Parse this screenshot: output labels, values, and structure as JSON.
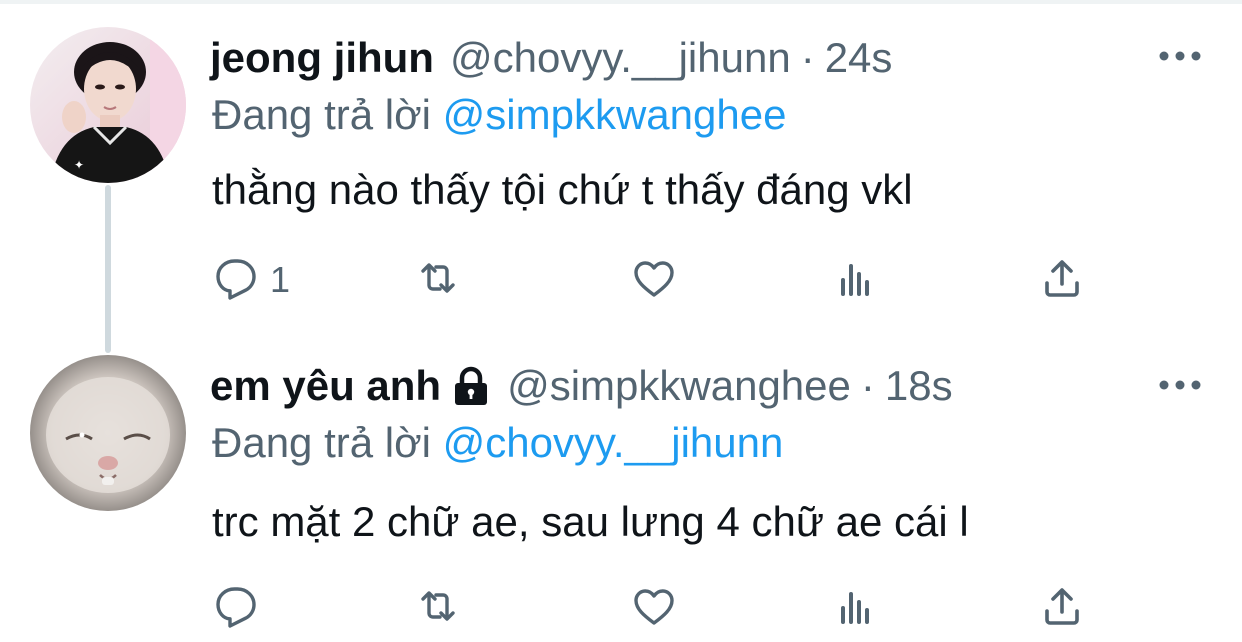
{
  "tweets": [
    {
      "name": "jeong jihun",
      "handle": "@chovyy.__jihunn",
      "separator": "·",
      "time": "24s",
      "reply_prefix": "Đang trả lời ",
      "reply_to": "@simpkkwanghee",
      "text": "thằng nào thấy tội chứ t thấy đáng vkl",
      "reply_count": "1",
      "retweet_count": "",
      "like_count": "",
      "protected": false
    },
    {
      "name": "em yêu anh",
      "handle": "@simpkkwanghee",
      "separator": "·",
      "time": "18s",
      "reply_prefix": "Đang trả lời ",
      "reply_to": "@chovyy.__jihunn",
      "text": "trc mặt 2 chữ ae, sau lưng 4 chữ ae cái l",
      "reply_count": "",
      "retweet_count": "",
      "like_count": "",
      "protected": true
    }
  ],
  "icons": {
    "reply": "reply-icon",
    "retweet": "retweet-icon",
    "like": "like-icon",
    "analytics": "analytics-icon",
    "share": "share-icon",
    "more": "more-icon",
    "lock": "lock-icon"
  },
  "colors": {
    "link": "#1d9bf0",
    "secondary": "#536471",
    "text": "#0f1419",
    "thread_line": "#cfd9de"
  }
}
